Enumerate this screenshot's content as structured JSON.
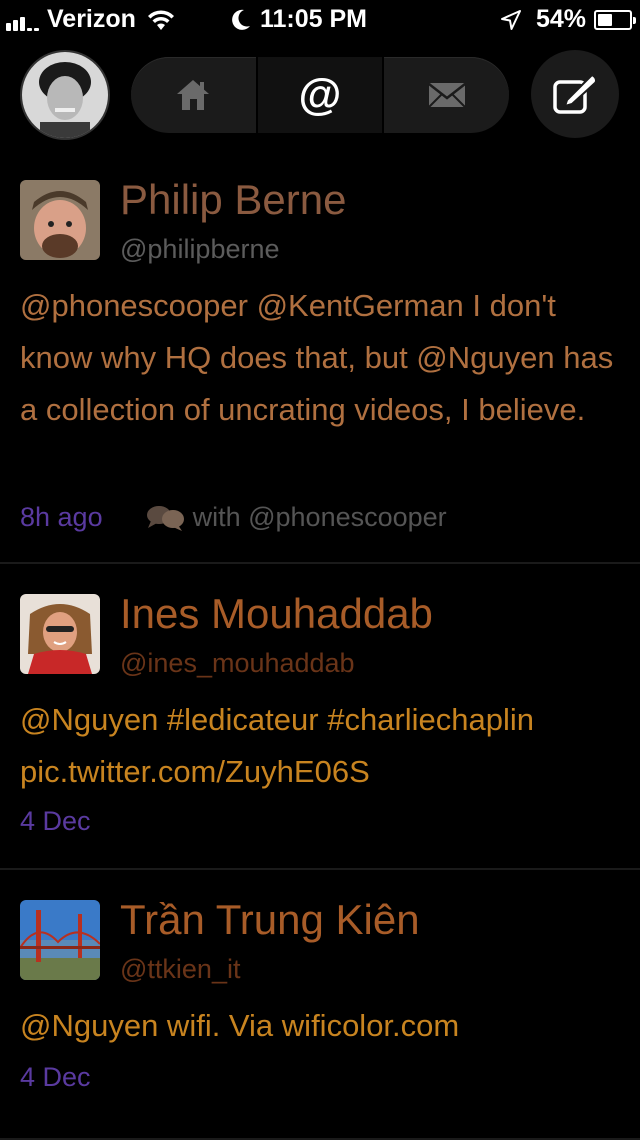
{
  "status_bar": {
    "carrier": "Verizon",
    "time": "11:05 PM",
    "battery": "54%",
    "battery_level": 0.54
  },
  "nav": {
    "tabs": [
      {
        "icon": "home-icon"
      },
      {
        "icon": "at-mention-icon",
        "label": "@"
      },
      {
        "icon": "envelope-icon"
      }
    ],
    "active_tab": 1,
    "compose_icon": "compose-icon"
  },
  "tweets": [
    {
      "name": "Philip Berne",
      "handle": "@philipberne",
      "text": "@phonescooper @KentGerman I don't know why HQ does that, but @Nguyen has a collection of uncrating videos, I believe.",
      "time": "8h ago",
      "conversation": "with @phonescooper"
    },
    {
      "name": "Ines Mouhaddab",
      "handle": "@ines_mouhaddab",
      "text": "@Nguyen #ledicateur #charliechaplin pic.twitter.com/ZuyhE06S",
      "time": "4 Dec"
    },
    {
      "name": "Trần Trung Kiên",
      "handle": "@ttkien_it",
      "text": "@Nguyen wifi. Via wificolor.com",
      "time": "4 Dec"
    }
  ],
  "colors": {
    "background": "#000000",
    "name": "#8a5a40",
    "body": "#c07840",
    "time": "#5a3aa0"
  }
}
